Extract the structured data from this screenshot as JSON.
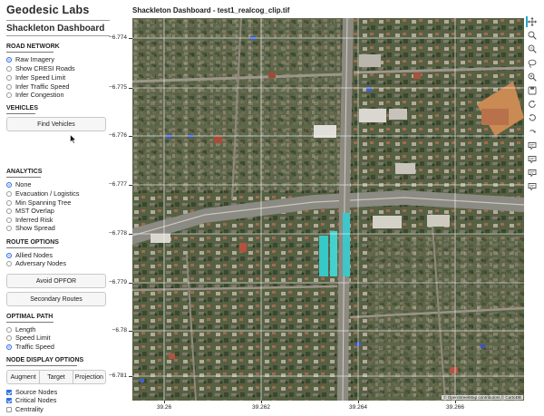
{
  "sidebar": {
    "brand": "Geodesic Labs",
    "dashboard_title": "Shackleton Dashboard",
    "road_network": {
      "heading": "ROAD NETWORK",
      "options": [
        "Raw Imagery",
        "Show CRESI Roads",
        "Infer Speed Limit",
        "Infer Traffic Speed",
        "Infer Congestion"
      ],
      "selected": 0
    },
    "vehicles": {
      "heading": "VEHICLES",
      "button": "Find Vehicles"
    },
    "analytics": {
      "heading": "ANALYTICS",
      "options": [
        "None",
        "Evacuation / Logistics",
        "Min Spanning Tree",
        "MST Overlap",
        "Inferred Risk",
        "Show Spread"
      ],
      "selected": 0
    },
    "route_options": {
      "heading": "ROUTE OPTIONS",
      "options": [
        "Allied Nodes",
        "Adversary Nodes"
      ],
      "selected": 0,
      "avoid_button": "Avoid OPFOR",
      "secondary_button": "Secondary Routes"
    },
    "optimal_path": {
      "heading": "OPTIMAL PATH",
      "options": [
        "Length",
        "Speed Limit",
        "Traffic Speed"
      ],
      "selected": 2
    },
    "node_display": {
      "heading": "NODE DISPLAY OPTIONS",
      "buttons": [
        "Augment",
        "Target",
        "Projection"
      ],
      "checks": [
        {
          "label": "Source Nodes",
          "checked": true
        },
        {
          "label": "Critical Nodes",
          "checked": true
        },
        {
          "label": "Centrality",
          "checked": false
        }
      ]
    }
  },
  "plot": {
    "title": "Shackleton Dashboard - test1_realcog_clip.tif",
    "y_ticks": [
      "−6.774",
      "−6.775",
      "−6.776",
      "−6.777",
      "−6.778",
      "−6.779",
      "−6.78",
      "−6.781"
    ],
    "x_ticks": [
      "39.26",
      "39.262",
      "39.264",
      "39.266"
    ],
    "attribution": "© OpenStreetMap contributors,© CartoDB"
  },
  "toolbar": {
    "tools": [
      "pan-icon",
      "box-zoom-icon",
      "wheel-zoom-icon",
      "lasso-icon",
      "zoom-in-icon",
      "save-icon",
      "reset-icon",
      "undo-icon",
      "redo-icon",
      "hover-icon",
      "hover-icon",
      "hover-icon",
      "hover-icon"
    ]
  },
  "colors": {
    "accent": "#2f6fe6",
    "toolbar_active": "#26a6c8",
    "imagery_base": "#5b6248"
  }
}
